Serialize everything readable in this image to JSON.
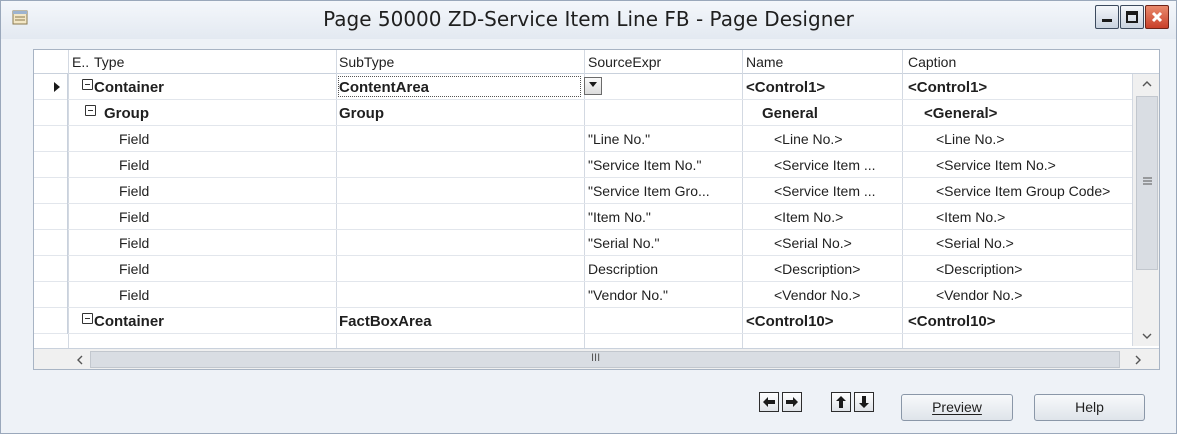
{
  "window": {
    "title": "Page 50000 ZD-Service Item Line FB - Page Designer"
  },
  "grid": {
    "columns": [
      "E..",
      "Type",
      "SubType",
      "SourceExpr",
      "Name",
      "Caption"
    ],
    "rows": [
      {
        "type": "Container",
        "subtype": "ContentArea",
        "source": "",
        "name": "<Control1>",
        "caption": "<Control1>",
        "bold": true,
        "expander": true,
        "current": true
      },
      {
        "type": "Group",
        "subtype": "Group",
        "source": "",
        "name": "General",
        "caption": "<General>",
        "bold": true,
        "expander": true
      },
      {
        "type": "Field",
        "subtype": "",
        "source": "\"Line No.\"",
        "name": "<Line No.>",
        "caption": "<Line No.>"
      },
      {
        "type": "Field",
        "subtype": "",
        "source": "\"Service Item No.\"",
        "name": "<Service Item ...",
        "caption": "<Service Item No.>"
      },
      {
        "type": "Field",
        "subtype": "",
        "source": "\"Service Item Gro...",
        "name": "<Service Item ...",
        "caption": "<Service Item Group Code>"
      },
      {
        "type": "Field",
        "subtype": "",
        "source": "\"Item No.\"",
        "name": "<Item No.>",
        "caption": "<Item No.>"
      },
      {
        "type": "Field",
        "subtype": "",
        "source": "\"Serial No.\"",
        "name": "<Serial No.>",
        "caption": "<Serial No.>"
      },
      {
        "type": "Field",
        "subtype": "",
        "source": "Description",
        "name": "<Description>",
        "caption": "<Description>"
      },
      {
        "type": "Field",
        "subtype": "",
        "source": "\"Vendor No.\"",
        "name": "<Vendor No.>",
        "caption": "<Vendor No.>"
      },
      {
        "type": "Container",
        "subtype": "FactBoxArea",
        "source": "",
        "name": "<Control10>",
        "caption": "<Control10>",
        "bold": true,
        "expander": true
      }
    ]
  },
  "buttons": {
    "preview": "Preview",
    "help": "Help"
  },
  "icons": {
    "nav": [
      "arrow-left-icon",
      "arrow-right-icon",
      "arrow-up-icon",
      "arrow-down-icon"
    ],
    "scroll_mid": "III"
  }
}
